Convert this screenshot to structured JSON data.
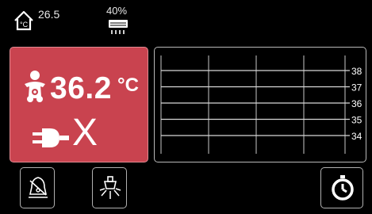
{
  "status_bar": {
    "room_temperature": "26.5",
    "humidity": "40%",
    "icons": {
      "room": "house-celsius-icon",
      "humidity": "humidifier-icon"
    }
  },
  "alarm_panel": {
    "skin_temperature": "36.2",
    "temperature_unit": "°C",
    "disconnect_mark": "X",
    "accent_color": "#c9434f",
    "icons": {
      "patient": "baby-icon",
      "probe": "plug-icon"
    }
  },
  "chart_data": {
    "type": "line",
    "yticks": [
      "38",
      "37",
      "36",
      "35",
      "34"
    ],
    "ylim": [
      34,
      38
    ],
    "grid": true,
    "series": []
  },
  "toolbar": {
    "icons": [
      "alarm-bell-icon",
      "lamp-icon",
      "timer-icon"
    ]
  }
}
